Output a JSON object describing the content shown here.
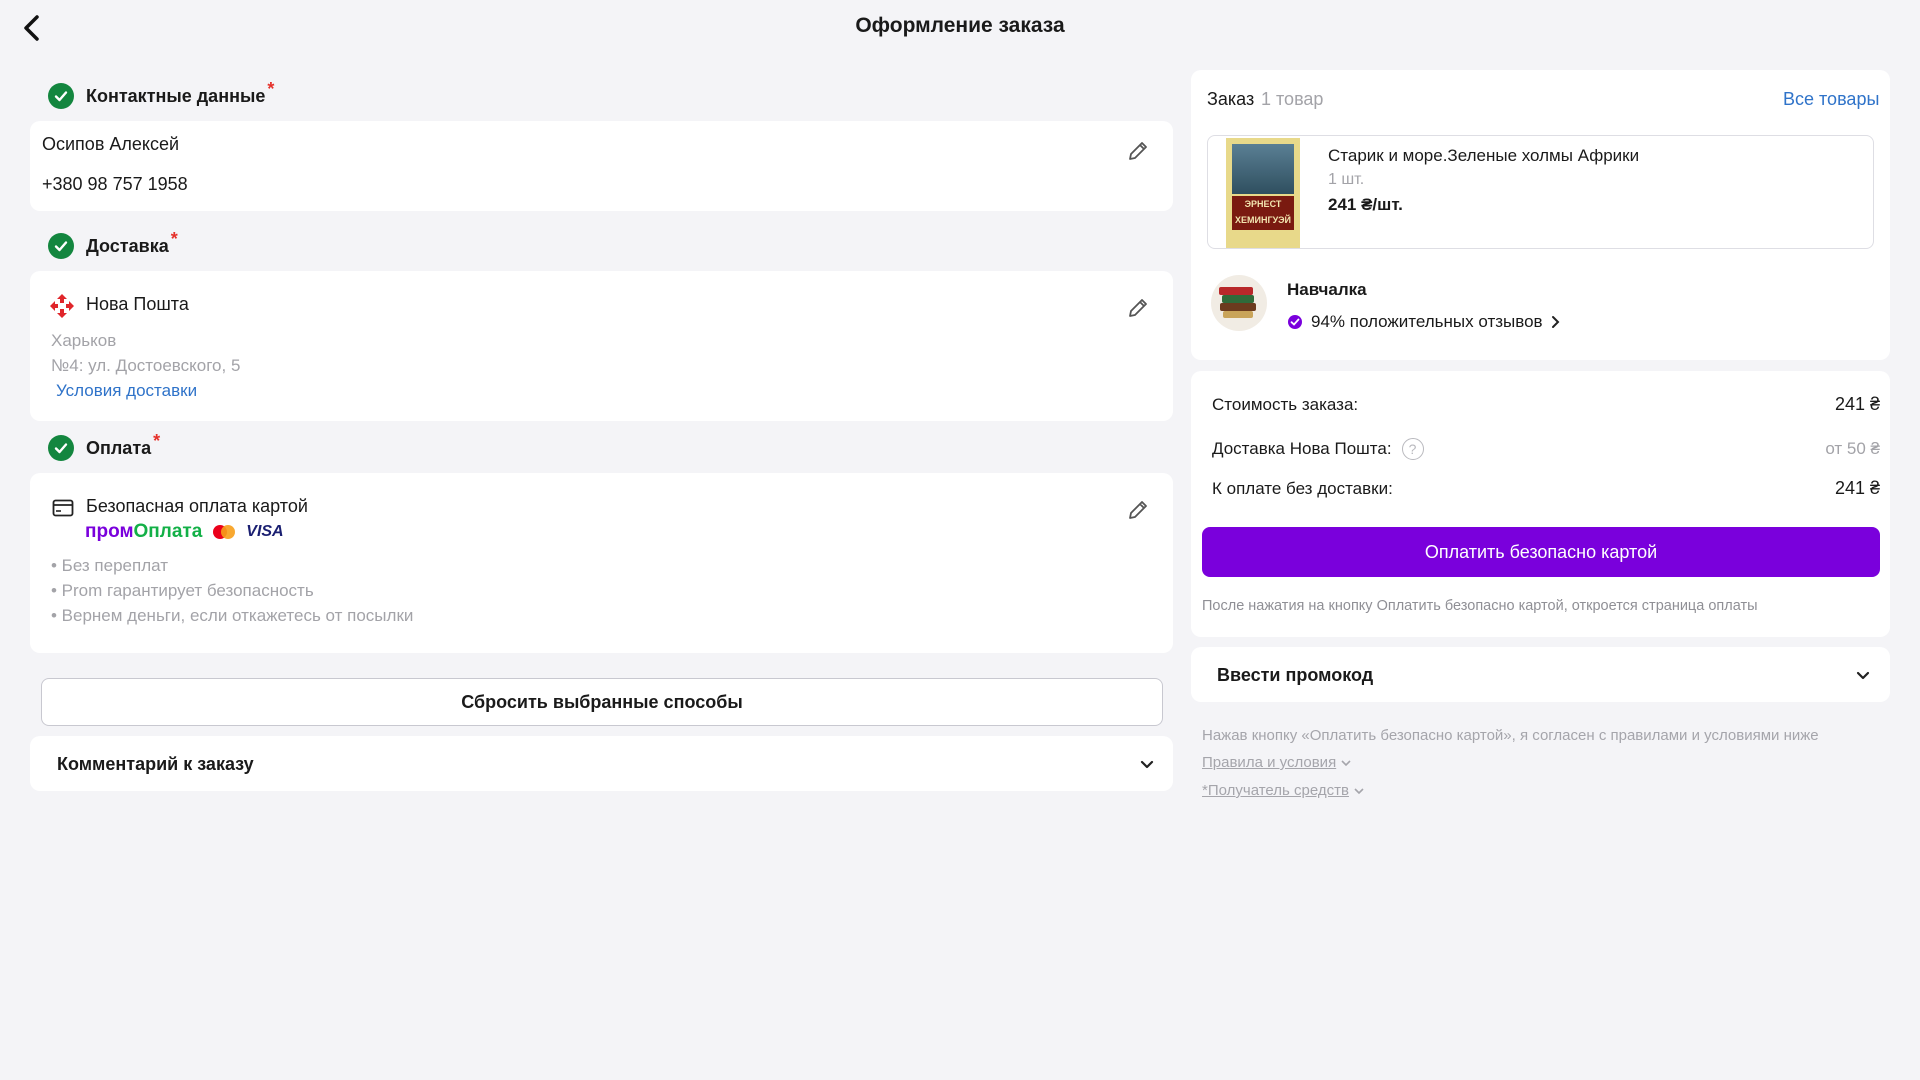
{
  "header": {
    "title": "Оформление заказа"
  },
  "contacts": {
    "title": "Контактные данные",
    "required_mark": "*",
    "name": "Осипов Алексей",
    "phone": "+380 98 757 1958"
  },
  "delivery": {
    "title": "Доставка",
    "required_mark": "*",
    "carrier": "Нова Пошта",
    "city": "Харьков",
    "branch": "№4: ул. Достоевского, 5",
    "conditions_link": "Условия доставки"
  },
  "payment": {
    "title": "Оплата",
    "required_mark": "*",
    "method": "Безопасная оплата картой",
    "brand_prom": "пром",
    "brand_oplata": "Оплата",
    "visa": "VISA",
    "bullets": [
      "• Без переплат",
      "• Prom гарантирует безопасность",
      "• Вернем деньги, если откажетесь от посылки"
    ]
  },
  "reset_button": "Сбросить выбранные способы",
  "comment": {
    "label": "Комментарий к заказу"
  },
  "order": {
    "label": "Заказ",
    "count": "1 товар",
    "all_items_link": "Все товары",
    "item": {
      "title": "Старик и море.Зеленые холмы Африки",
      "qty": "1 шт.",
      "price": "241 ₴/шт.",
      "cover_author_line1": "ЭРНЕСТ",
      "cover_author_line2": "ХЕМИНГУЭЙ"
    },
    "seller": {
      "name": "Навчалка",
      "rating": "94% положительных отзывов"
    }
  },
  "summary": {
    "cost_label": "Стоимость заказа:",
    "cost_value": "241 ₴",
    "delivery_label": "Доставка Нова Пошта:",
    "delivery_value": "от 50 ₴",
    "topay_label": "К оплате без доставки:",
    "topay_value": "241 ₴",
    "pay_button": "Оплатить безопасно картой",
    "note": "После нажатия на кнопку Оплатить безопасно картой, откроется страница оплаты"
  },
  "promo": {
    "label": "Ввести промокод"
  },
  "legal": {
    "agreement": "Нажав кнопку «Оплатить безопасно картой», я согласен с правилами и условиями ниже",
    "rules_link": "Правила и условия",
    "recipient_link": "*Получатель средств"
  },
  "colors": {
    "accent": "#7a00dc",
    "success": "#13863f",
    "link": "#2f73c9",
    "required": "#e5302a",
    "background": "#f4f4f7"
  },
  "icons": [
    "back-arrow-icon",
    "check-icon",
    "pencil-icon",
    "nova-poshta-logo-icon",
    "card-icon",
    "mastercard-icon",
    "seller-avatar-icon",
    "verified-badge-icon",
    "chevron-right-icon",
    "chevron-down-icon",
    "help-icon"
  ]
}
